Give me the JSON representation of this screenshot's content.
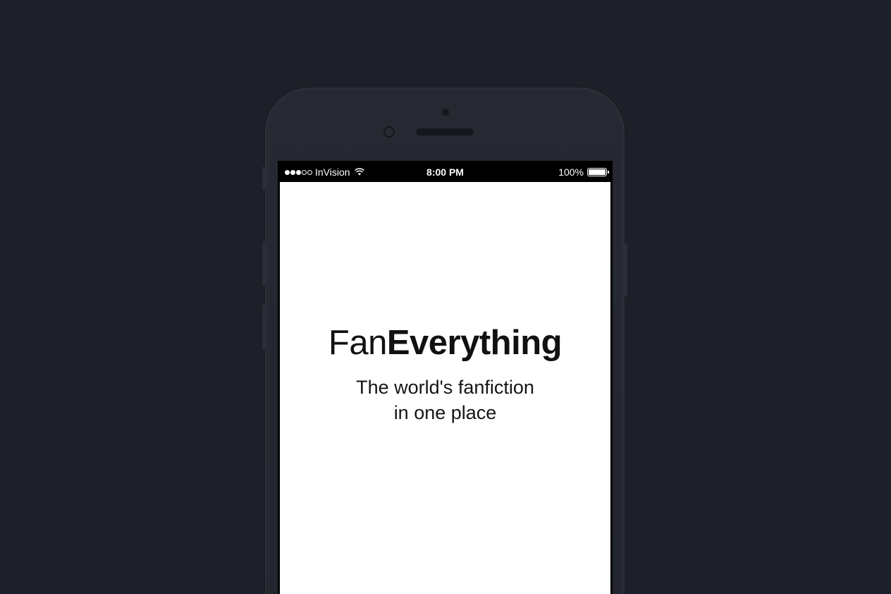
{
  "status_bar": {
    "carrier": "InVision",
    "time": "8:00 PM",
    "battery_percent": "100%",
    "signal_bars_filled": 3,
    "signal_bars_total": 5,
    "battery_level": 1.0
  },
  "app": {
    "brand_prefix": "Fan",
    "brand_suffix": "Everything",
    "tagline_line1": "The world's fanfiction",
    "tagline_line2": "in one place"
  },
  "colors": {
    "background": "#1e2029",
    "phone_body": "#262932",
    "screen_bg": "#ffffff",
    "text": "#111111"
  },
  "icons": {
    "signal": "signal-dots-icon",
    "wifi": "wifi-icon",
    "battery": "battery-icon"
  }
}
